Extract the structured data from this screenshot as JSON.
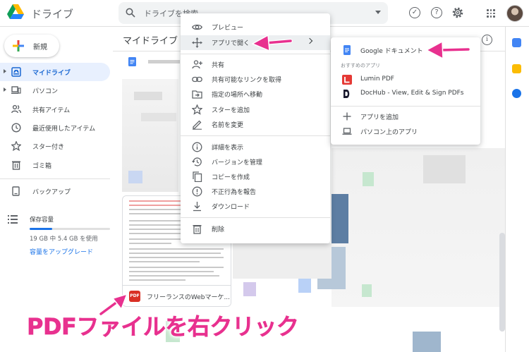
{
  "app": {
    "title": "ドライブ"
  },
  "search": {
    "placeholder": "ドライブを検索"
  },
  "top_icons": [
    "done-circle-icon",
    "help-icon",
    "settings-icon",
    "apps-grid-icon",
    "avatar"
  ],
  "sidebar": {
    "new_label": "新規",
    "items": [
      {
        "label": "マイドライブ",
        "icon": "my-drive-icon",
        "active": true
      },
      {
        "label": "パソコン",
        "icon": "computer-icon",
        "active": false
      },
      {
        "label": "共有アイテム",
        "icon": "shared-icon",
        "active": false
      },
      {
        "label": "最近使用したアイテム",
        "icon": "clock-icon",
        "active": false
      },
      {
        "label": "スター付き",
        "icon": "star-icon",
        "active": false
      },
      {
        "label": "ゴミ箱",
        "icon": "trash-icon",
        "active": false
      },
      {
        "label": "バックアップ",
        "icon": "backup-icon",
        "active": false
      }
    ],
    "storage": {
      "title": "保存容量",
      "usage": "19 GB 中 5.4 GB を使用",
      "used_fraction": 0.28,
      "upgrade": "容量をアップグレード"
    }
  },
  "content": {
    "title": "マイドライブ",
    "file_card": {
      "name": "フリーランスのWebマーケ...",
      "badge": "PDF"
    }
  },
  "context_menu": {
    "items": [
      {
        "label": "プレビュー",
        "icon": "eye-icon"
      },
      {
        "label": "アプリで開く",
        "icon": "move-arrows-icon",
        "has_submenu": true
      },
      {
        "label": "共有",
        "icon": "share-person-icon"
      },
      {
        "label": "共有可能なリンクを取得",
        "icon": "link-icon"
      },
      {
        "label": "指定の場所へ移動",
        "icon": "move-folder-icon"
      },
      {
        "label": "スターを追加",
        "icon": "star-icon"
      },
      {
        "label": "名前を変更",
        "icon": "pencil-icon"
      },
      {
        "label": "詳細を表示",
        "icon": "info-icon"
      },
      {
        "label": "バージョンを管理",
        "icon": "history-icon"
      },
      {
        "label": "コピーを作成",
        "icon": "copy-icon"
      },
      {
        "label": "不正行為を報告",
        "icon": "report-icon"
      },
      {
        "label": "ダウンロード",
        "icon": "download-icon"
      },
      {
        "label": "削除",
        "icon": "trash-icon"
      }
    ]
  },
  "submenu": {
    "top_app": {
      "label": "Google ドキュメント",
      "icon": "google-docs-icon"
    },
    "section_label": "おすすめのアプリ",
    "suggested": [
      {
        "label": "Lumin PDF",
        "icon": "lumin-pdf-icon"
      },
      {
        "label": "DocHub - View, Edit & Sign PDFs",
        "icon": "dochub-icon"
      }
    ],
    "actions": [
      {
        "label": "アプリを追加",
        "icon": "plus-icon"
      },
      {
        "label": "パソコン上のアプリ",
        "icon": "laptop-icon"
      }
    ]
  },
  "annotation": {
    "text": "PDFファイルを右クリック",
    "color": "#e8318f"
  },
  "colors": {
    "accent": "#1a73e8",
    "active_bg": "#e8f0fe",
    "annotation": "#e8318f",
    "pdf_red": "#d93025"
  }
}
